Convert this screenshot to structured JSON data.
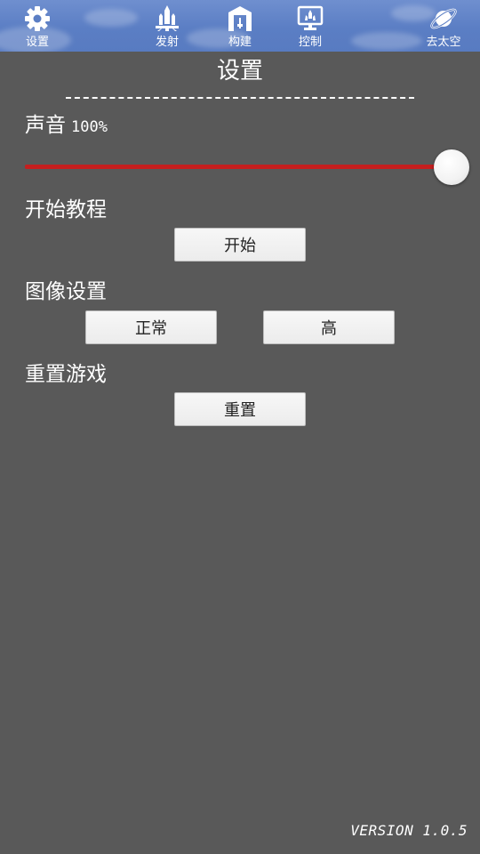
{
  "nav": {
    "items": [
      {
        "id": "settings",
        "label": "设置",
        "icon": "gear-icon"
      },
      {
        "id": "launch",
        "label": "发射",
        "icon": "rocket-icon"
      },
      {
        "id": "build",
        "label": "构建",
        "icon": "hangar-icon"
      },
      {
        "id": "control",
        "label": "控制",
        "icon": "monitor-icon"
      },
      {
        "id": "space",
        "label": "去太空",
        "icon": "planet-icon"
      }
    ]
  },
  "page": {
    "title": "设置"
  },
  "sound": {
    "label": "声音",
    "value_text": "100%",
    "level": 1.0,
    "track_color": "#c51f1f"
  },
  "tutorial": {
    "label": "开始教程",
    "button": "开始"
  },
  "graphics": {
    "label": "图像设置",
    "normal_button": "正常",
    "high_button": "高"
  },
  "reset": {
    "label": "重置游戏",
    "button": "重置"
  },
  "footer": {
    "version": "VERSION 1.0.5"
  },
  "colors": {
    "background": "#595959",
    "nav_bar": "#5b7ec4",
    "button_bg": "#f2f2f2"
  }
}
